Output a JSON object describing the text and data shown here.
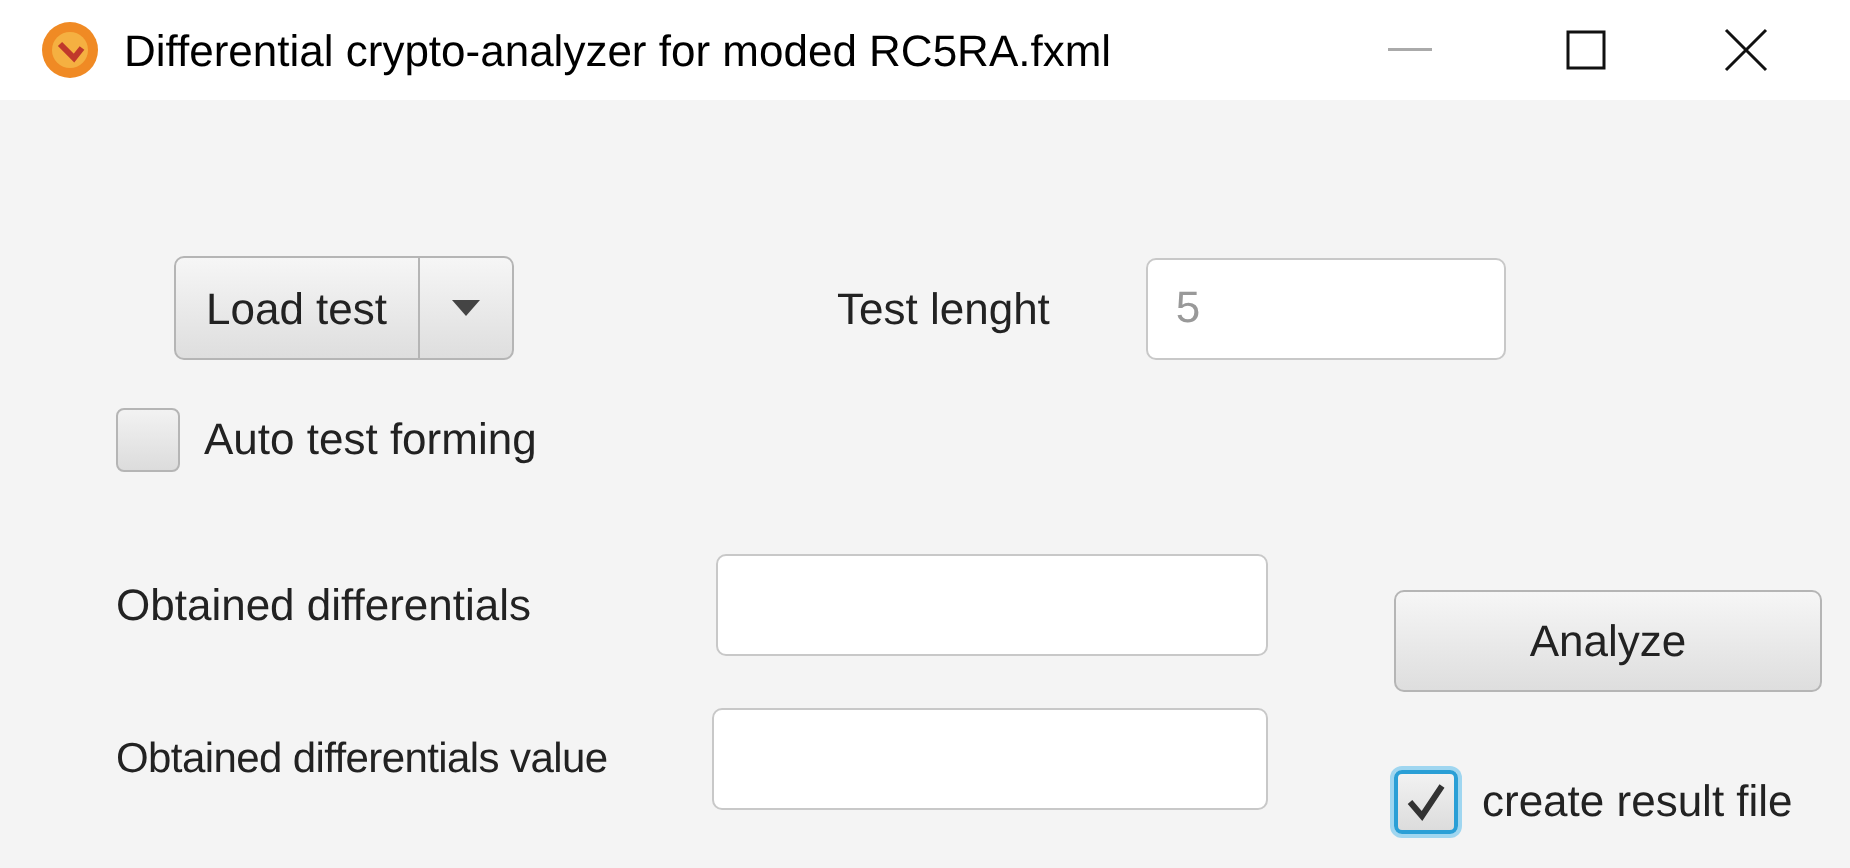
{
  "window": {
    "title": "Differential crypto-analyzer for moded RC5RA.fxml"
  },
  "load_button": {
    "label": "Load test"
  },
  "test_length": {
    "label": "Test lenght",
    "placeholder": "5"
  },
  "auto_test": {
    "label": "Auto test forming",
    "checked": false
  },
  "obtained_differentials": {
    "label": "Obtained differentials"
  },
  "obtained_value": {
    "label": "Obtained differentials value"
  },
  "analyze_button": {
    "label": "Analyze"
  },
  "result_file": {
    "label": "create result file",
    "checked": true
  }
}
